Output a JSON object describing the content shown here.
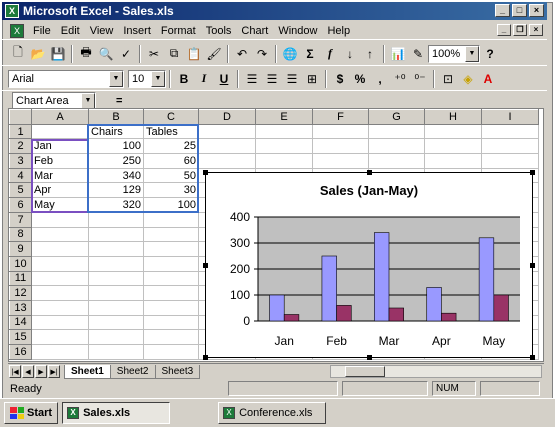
{
  "window": {
    "title": "Microsoft Excel - Sales.xls"
  },
  "menu": [
    "File",
    "Edit",
    "View",
    "Insert",
    "Format",
    "Tools",
    "Chart",
    "Window",
    "Help"
  ],
  "toolbar": {
    "zoom": "100%",
    "font_name": "Arial",
    "font_size": "10",
    "bold": "B",
    "italic": "I",
    "underline": "U",
    "currency": "$",
    "percent": "%",
    "comma": ",",
    "sum": "Σ",
    "fx": "f",
    "help": "?"
  },
  "formula_bar": {
    "name_box": "Chart Area",
    "equals": "="
  },
  "sheet": {
    "columns": [
      "A",
      "B",
      "C",
      "D",
      "E",
      "F",
      "G",
      "H",
      "I"
    ],
    "rows": [
      "1",
      "2",
      "3",
      "4",
      "5",
      "6",
      "7",
      "8",
      "9",
      "10",
      "11",
      "12",
      "13",
      "14",
      "15",
      "16"
    ],
    "cells": {
      "B1": "Chairs",
      "C1": "Tables",
      "A2": "Jan",
      "B2": "100",
      "C2": "25",
      "A3": "Feb",
      "B3": "250",
      "C3": "60",
      "A4": "Mar",
      "B4": "340",
      "C4": "50",
      "A5": "Apr",
      "B5": "129",
      "C5": "30",
      "A6": "May",
      "B6": "320",
      "C6": "100"
    }
  },
  "chart_data": {
    "type": "bar",
    "title": "Sales (Jan-May)",
    "categories": [
      "Jan",
      "Feb",
      "Mar",
      "Apr",
      "May"
    ],
    "series": [
      {
        "name": "Chairs",
        "values": [
          100,
          250,
          340,
          129,
          320
        ],
        "color": "#9999ff"
      },
      {
        "name": "Tables",
        "values": [
          25,
          60,
          50,
          30,
          100
        ],
        "color": "#993366"
      }
    ],
    "ylim": [
      0,
      400
    ],
    "yticks": [
      "0",
      "100",
      "200",
      "300",
      "400"
    ],
    "plot_background": "#c0c0c0",
    "legend": "none"
  },
  "tabs": [
    "Sheet1",
    "Sheet2",
    "Sheet3"
  ],
  "status": {
    "ready": "Ready",
    "num": "NUM"
  },
  "taskbar": {
    "start": "Start",
    "items": [
      "Sales.xls",
      "Conference.xls"
    ]
  }
}
